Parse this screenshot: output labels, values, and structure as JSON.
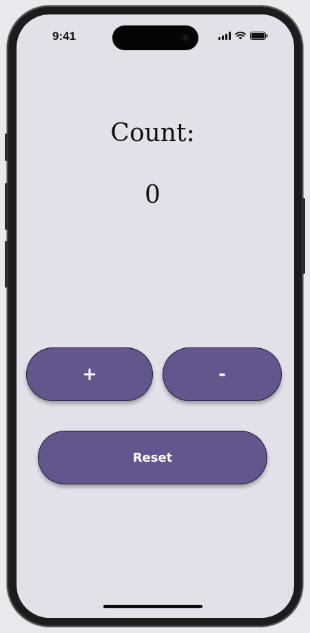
{
  "status_bar": {
    "time": "9:41",
    "icons": [
      "cellular-signal-icon",
      "wifi-icon",
      "battery-icon"
    ]
  },
  "counter": {
    "label": "Count:",
    "value": "0"
  },
  "buttons": {
    "increment_label": "+",
    "decrement_label": "-",
    "reset_label": "Reset"
  },
  "colors": {
    "screen_background": "#e2e1e9",
    "button_fill": "#64558c",
    "button_text": "#ffffff",
    "text": "#111111"
  }
}
